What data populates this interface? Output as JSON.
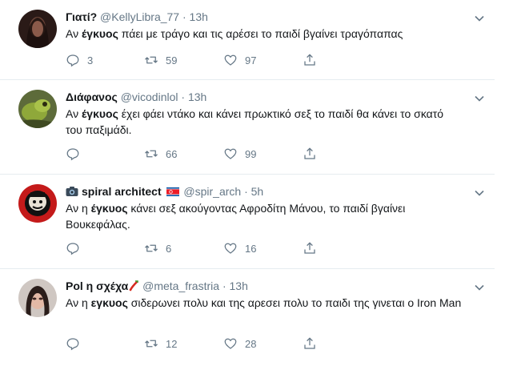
{
  "tweets": [
    {
      "name": "Γιατί?",
      "handle": "@KellyLibra_77",
      "dot": "·",
      "time": "13h",
      "text_before": "Αν ",
      "text_bold": "έγκυος",
      "text_after": " πάει με τράγο και τις αρέσει το παιδί βγαίνει τραγόπαπας",
      "replies": "3",
      "retweets": "59",
      "likes": "97"
    },
    {
      "name": "Διάφανος",
      "handle": "@vicodinlol",
      "dot": "·",
      "time": "13h",
      "text_before": "Αν ",
      "text_bold": "έγκυος",
      "text_after": " έχει φάει ντάκο και κάνει πρωκτικό σεξ το παιδί θα κάνει το σκατό του παξιμάδι.",
      "replies": "",
      "retweets": "66",
      "likes": "99"
    },
    {
      "name": "spiral architect",
      "handle": "@spir_arch",
      "dot": "·",
      "time": "5h",
      "text_before": "Αν η ",
      "text_bold": "έγκυος",
      "text_after": " κάνει σεξ ακούγοντας Αφροδίτη Μάνου, το παιδί βγαίνει Βουκεφάλας.",
      "replies": "",
      "retweets": "6",
      "likes": "16"
    },
    {
      "name": "Pol η σχέχα",
      "handle": "@meta_frastria",
      "dot": "·",
      "time": "13h",
      "text_before": "Αν η ",
      "text_bold": "εγκυος",
      "text_after": " σιδερωνει πολυ και της αρεσει πολυ το παιδι της γινεται ο Iron Man",
      "replies": "",
      "retweets": "12",
      "likes": "28"
    }
  ],
  "icons": {
    "reply": "reply-icon",
    "retweet": "retweet-icon",
    "like": "heart-icon",
    "share": "share-icon",
    "more": "chevron-down-icon"
  },
  "colors": {
    "text": "#14171a",
    "muted": "#657786",
    "divider": "#e6ecf0"
  }
}
